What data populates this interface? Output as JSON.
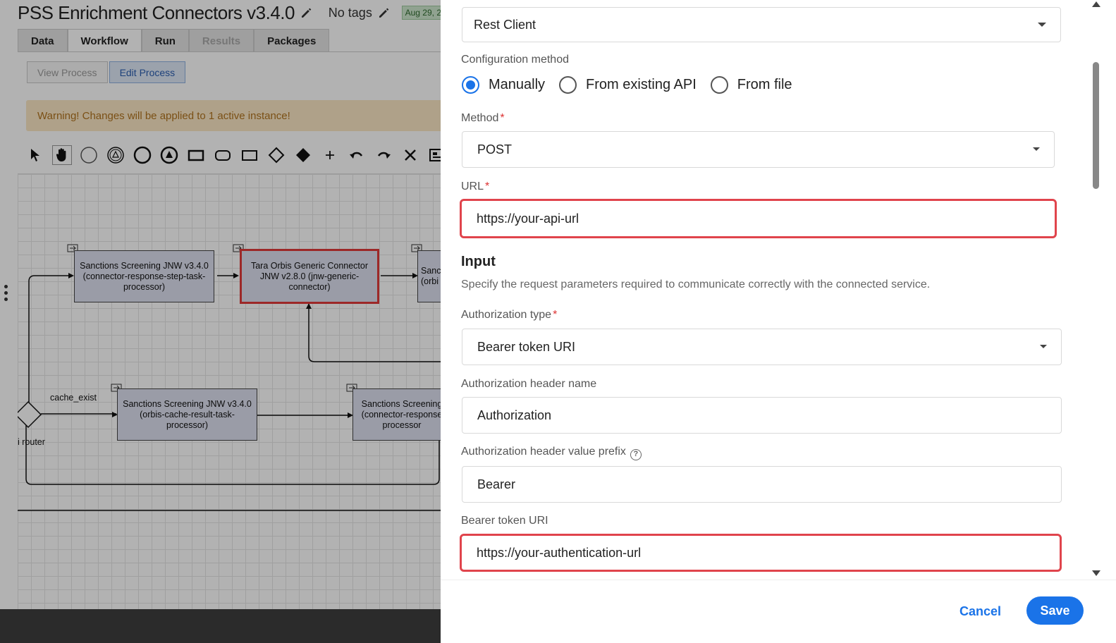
{
  "background_app": {
    "title": "PSS Enrichment Connectors v3.4.0",
    "tags_label": "No tags",
    "date_badge": "Aug 29, 2",
    "tabs": [
      {
        "label": "Data"
      },
      {
        "label": "Workflow"
      },
      {
        "label": "Run"
      },
      {
        "label": "Results"
      },
      {
        "label": "Packages"
      }
    ],
    "process_tabs": {
      "view": "View Process",
      "edit": "Edit Process"
    },
    "warning": "Warning! Changes will be applied to 1 active instance!",
    "nodes": {
      "n1": "Sanctions Screening JNW v3.4.0 (connector-response-step-task-processor)",
      "n2": "Tara Orbis Generic Connector JNW v2.8.0 (jnw-generic-connector)",
      "n3": "Sanc (orbi",
      "n4": "Sanctions Screening JNW v3.4.0 (orbis-cache-result-task-processor)",
      "n5": "Sanctions Screening (connector-response processor"
    },
    "labels": {
      "cache_exist": "cache_exist",
      "router": "i router"
    }
  },
  "panel": {
    "client_type": "Rest Client",
    "config_method_label": "Configuration method",
    "config_methods": [
      {
        "label": "Manually",
        "checked": true
      },
      {
        "label": "From existing API",
        "checked": false
      },
      {
        "label": "From file",
        "checked": false
      }
    ],
    "method_label": "Method",
    "method_value": "POST",
    "url_label": "URL",
    "url_value": "https://your-api-url",
    "input_title": "Input",
    "input_desc": "Specify the request parameters required to communicate correctly with the connected service.",
    "auth_type_label": "Authorization type",
    "auth_type_value": "Bearer token URI",
    "auth_header_name_label": "Authorization header name",
    "auth_header_name_value": "Authorization",
    "auth_prefix_label": "Authorization header value prefix",
    "auth_prefix_value": "Bearer",
    "bearer_uri_label": "Bearer token URI",
    "bearer_uri_value": "https://your-authentication-url",
    "required_mark": "*",
    "help_glyph": "?",
    "cancel_label": "Cancel",
    "save_label": "Save"
  },
  "colors": {
    "accent": "#1a73e8",
    "highlight": "#e0444c",
    "warning_bg": "#fbe7c4",
    "warning_text": "#b0731f"
  }
}
